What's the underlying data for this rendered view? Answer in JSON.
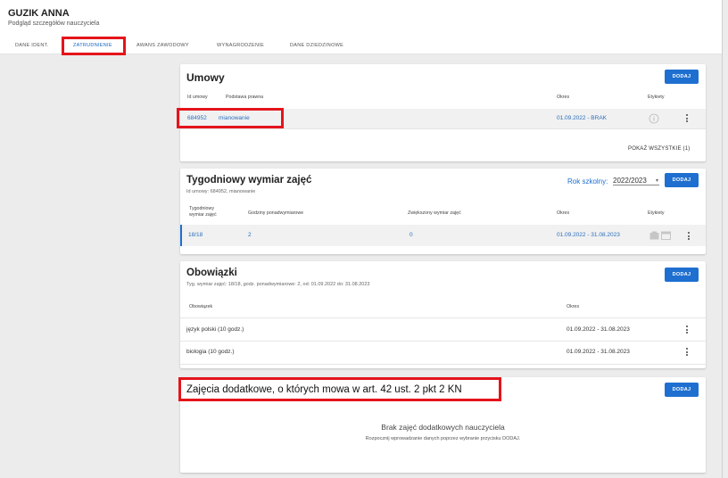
{
  "header": {
    "name": "GUZIK ANNA",
    "subtitle": "Podgląd szczegółów nauczyciela"
  },
  "tabs": [
    {
      "label": "DANE IDENT."
    },
    {
      "label": "ZATRUDNIENIE",
      "active": true
    },
    {
      "label": "AWANS ZAWODOWY"
    },
    {
      "label": "WYNAGRODZENIE"
    },
    {
      "label": "DANE DZIEDZINOWE"
    }
  ],
  "umowy": {
    "title": "Umowy",
    "add_label": "DODAJ",
    "columns": [
      "Id umowy",
      "Podstawa prawna",
      "Okres",
      "Etykiety"
    ],
    "row": {
      "id": "684952",
      "basis": "mianowanie",
      "period": "01.09.2022 - BRAK"
    },
    "show_all": "POKAŻ WSZYSTKIE (1)"
  },
  "tygodniowy": {
    "title": "Tygodniowy wymiar zajęć",
    "subtitle": "Id umowy: 684952, mianowanie",
    "year_label": "Rok szkolny:",
    "year_value": "2022/2023",
    "add_label": "DODAJ",
    "columns": [
      "Tygodniowy",
      "wymiar zajęć",
      "Godziny ponadwymiarowe",
      "Zwiększony wymiar zajęć",
      "Okres",
      "Etykiety"
    ],
    "row": {
      "wymiar": "18/18",
      "ponad": "2",
      "zwiekszony": "0",
      "period": "01.09.2022 - 31.08.2023"
    }
  },
  "obowiazki": {
    "title": "Obowiązki",
    "subtitle": "Tyg. wymiar zajęć: 18/18, godz. ponadwymiarowe: 2, od: 01.09.2022 do: 31.08.2023",
    "add_label": "DODAJ",
    "columns": [
      "Obowiązek",
      "Okres"
    ],
    "rows": [
      {
        "name": "język polski (10 godz.)",
        "period": "01.09.2022 - 31.08.2023"
      },
      {
        "name": "biologia (10 godz.)",
        "period": "01.09.2022 - 31.08.2023"
      }
    ]
  },
  "dodatkowe": {
    "title": "Zajęcia dodatkowe, o których mowa w art. 42 ust. 2 pkt 2 KN",
    "add_label": "DODAJ",
    "empty_title": "Brak zajęć dodatkowych nauczyciela",
    "empty_sub": "Rozpocznij wprowadzanie danych poprzez wybranie przycisku DODAJ."
  }
}
